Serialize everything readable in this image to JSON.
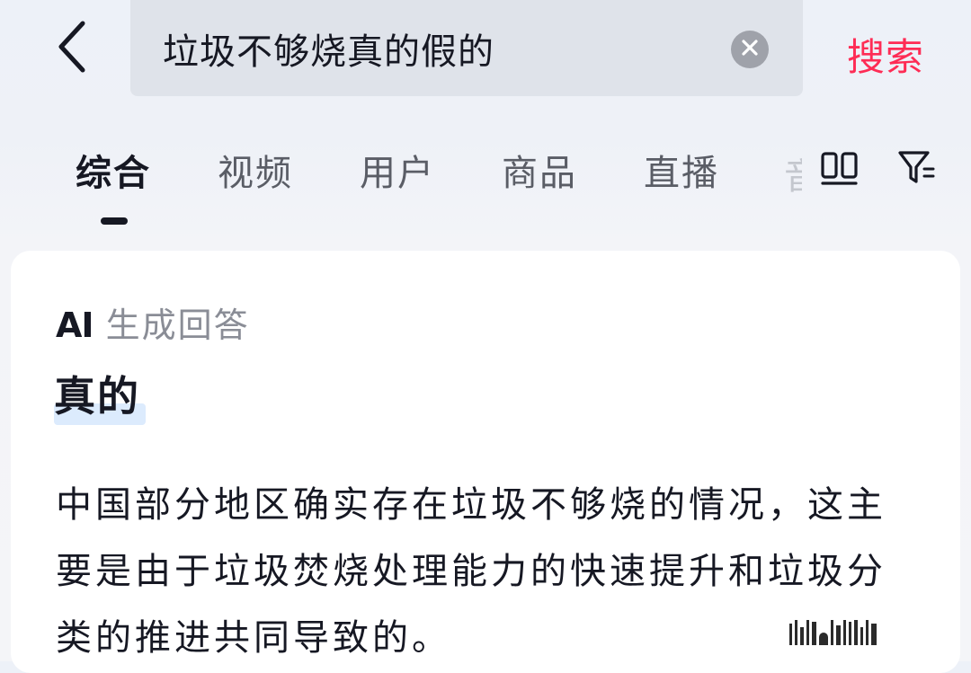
{
  "header": {
    "search_value": "垃圾不够烧真的假的",
    "search_button": "搜索"
  },
  "tabs": [
    {
      "label": "综合",
      "active": true
    },
    {
      "label": "视频",
      "active": false
    },
    {
      "label": "用户",
      "active": false
    },
    {
      "label": "商品",
      "active": false
    },
    {
      "label": "直播",
      "active": false
    },
    {
      "label": "音",
      "active": false
    }
  ],
  "icons": {
    "back": "chevron-left-icon",
    "clear": "clear-circle-icon",
    "layout": "double-column-icon",
    "filter": "filter-icon"
  },
  "ai_card": {
    "badge_mark": "AI",
    "badge_text": "生成回答",
    "answer": "真的",
    "body": "中国部分地区确实存在垃圾不够烧的情况，这主要是由于垃圾焚烧处理能力的快速提升和垃圾分类的推进共同导致的。"
  },
  "colors": {
    "accent": "#fe2c55",
    "text_primary": "#161823",
    "text_secondary": "#8a8d96",
    "highlight": "#dcebfd"
  }
}
